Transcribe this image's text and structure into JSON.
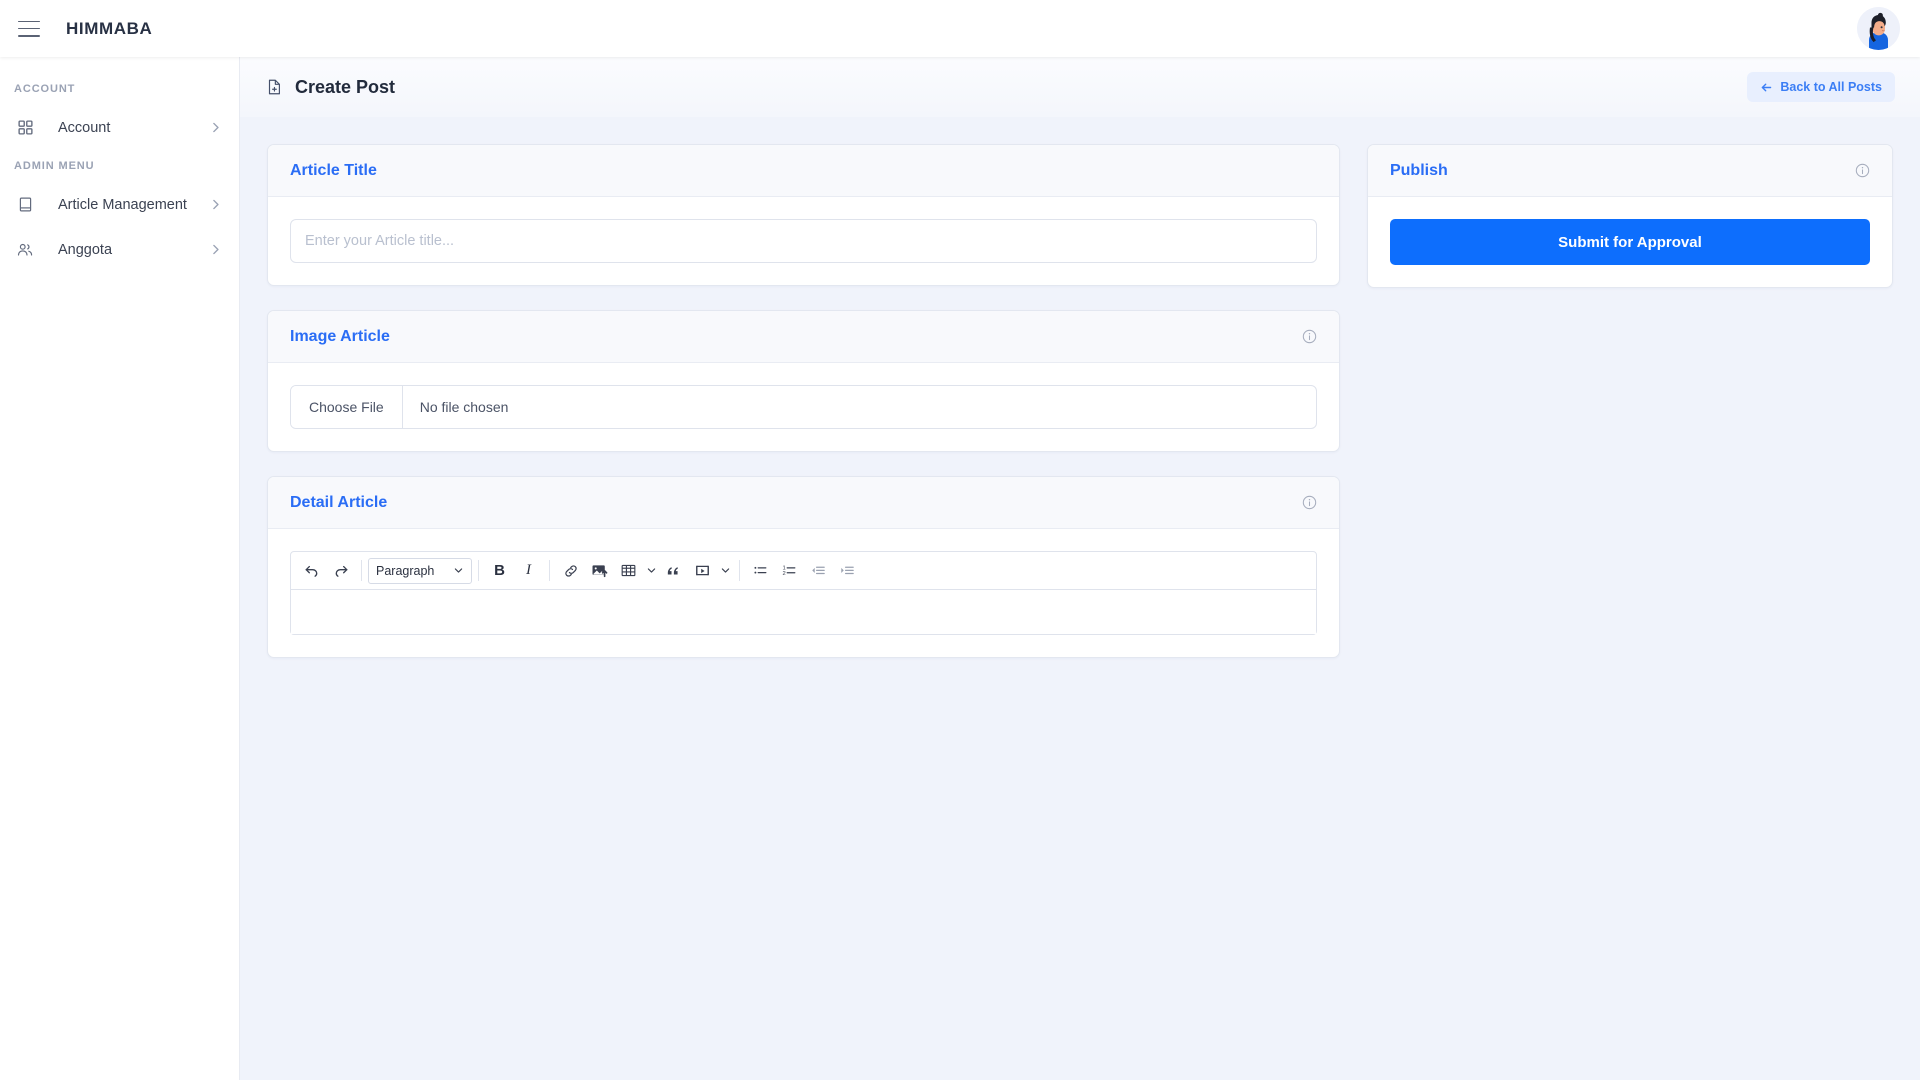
{
  "topbar": {
    "menu_icon": "hamburger-icon",
    "brand": "HIMMABA",
    "avatar_icon": "user-avatar"
  },
  "sidebar": {
    "sections": [
      {
        "caption": "ACCOUNT",
        "items": [
          {
            "label": "Account",
            "icon": "grid-icon",
            "chevron": "chevron-right-icon"
          }
        ]
      },
      {
        "caption": "ADMIN MENU",
        "items": [
          {
            "label": "Article Management",
            "icon": "book-icon",
            "chevron": "chevron-right-icon"
          },
          {
            "label": "Anggota",
            "icon": "users-icon",
            "chevron": "chevron-right-icon"
          }
        ]
      }
    ]
  },
  "page_header": {
    "icon": "file-plus-icon",
    "title": "Create Post",
    "back_button": {
      "arrow": "arrow-left-icon",
      "label": "Back to All Posts"
    }
  },
  "cards": {
    "article_title": {
      "title": "Article Title",
      "input_placeholder": "Enter your Article title...",
      "input_value": ""
    },
    "image_article": {
      "title": "Image Article",
      "info_icon": "info-circle-icon",
      "choose_file_label": "Choose File",
      "file_status": "No file chosen"
    },
    "detail_article": {
      "title": "Detail Article",
      "info_icon": "info-circle-icon",
      "editor_content": ""
    },
    "publish": {
      "title": "Publish",
      "info_icon": "info-circle-icon",
      "submit_label": "Submit for Approval"
    }
  },
  "editor_toolbar": {
    "undo": "undo-icon",
    "redo": "redo-icon",
    "block_format": "Paragraph",
    "bold": "B",
    "italic": "I",
    "link": "link-icon",
    "image": "image-upload-icon",
    "table": "table-icon",
    "blockquote": "quote-icon",
    "video": "video-icon",
    "bullet_list": "bullet-list-icon",
    "numbered_list": "numbered-list-icon",
    "outdent": "outdent-icon",
    "indent": "indent-icon"
  },
  "colors": {
    "accent_blue": "#2a6df5",
    "button_blue": "#0d6efd",
    "page_background": "#f0f3fb",
    "card_header": "#f8f9fc"
  }
}
